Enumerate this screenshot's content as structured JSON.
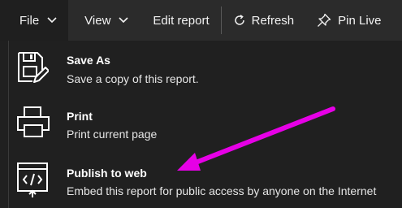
{
  "toolbar": {
    "file_label": "File",
    "view_label": "View",
    "edit_report_label": "Edit report",
    "refresh_label": "Refresh",
    "pin_live_label": "Pin Live"
  },
  "menu": {
    "items": [
      {
        "icon": "save-as-icon",
        "title": "Save As",
        "description": "Save a copy of this report."
      },
      {
        "icon": "printer-icon",
        "title": "Print",
        "description": "Print current page"
      },
      {
        "icon": "publish-to-web-icon",
        "title": "Publish to web",
        "description": "Embed this report for public access by anyone on the Internet"
      }
    ]
  },
  "colors": {
    "toolbar_bg": "#2b2b2b",
    "menu_bg": "#202020",
    "annotation_arrow": "#e600e6"
  }
}
